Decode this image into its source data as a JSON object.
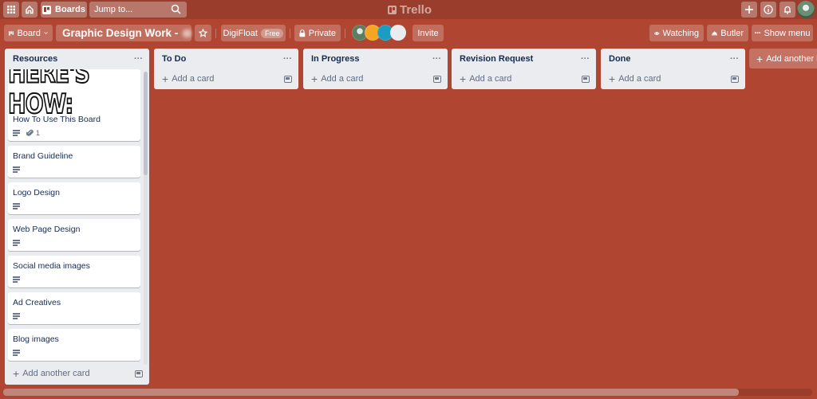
{
  "topbar": {
    "boards_label": "Boards",
    "search_placeholder": "Jump to...",
    "logo_text": "Trello"
  },
  "board_header": {
    "view_label": "Board",
    "title": "Graphic Design Work -",
    "team_name": "DigiFloat",
    "team_badge": "Free",
    "visibility_label": "Private",
    "invite_label": "Invite",
    "watching_label": "Watching",
    "butler_label": "Butler",
    "show_menu_label": "Show menu",
    "members": [
      {
        "name": "member-1",
        "color": "#5b7e62"
      },
      {
        "name": "member-2",
        "color": "#f5a623"
      },
      {
        "name": "member-3",
        "color": "#1a9cc4"
      },
      {
        "name": "member-4",
        "color": "#e9ebee"
      }
    ]
  },
  "lists": [
    {
      "title": "Resources",
      "cover_text": "HERE'S HOW:",
      "cards": [
        {
          "title": "How To Use This Board",
          "has_description": true,
          "attachments": "1"
        },
        {
          "title": "Brand Guideline",
          "has_description": true
        },
        {
          "title": "Logo Design",
          "has_description": true
        },
        {
          "title": "Web Page Design",
          "has_description": true
        },
        {
          "title": "Social media images",
          "has_description": true
        },
        {
          "title": "Ad Creatives",
          "has_description": true
        },
        {
          "title": "Blog images",
          "has_description": true
        }
      ],
      "add_label": "Add another card"
    },
    {
      "title": "To Do",
      "cards": [],
      "add_label": "Add a card"
    },
    {
      "title": "In Progress",
      "cards": [],
      "add_label": "Add a card"
    },
    {
      "title": "Revision Request",
      "cards": [],
      "add_label": "Add a card"
    },
    {
      "title": "Done",
      "cards": [],
      "add_label": "Add a card"
    }
  ],
  "add_list_label": "Add another list",
  "colors": {
    "board_background": "#b04632",
    "topbar": "#9a3d2c",
    "list_background": "#ebecf0"
  }
}
